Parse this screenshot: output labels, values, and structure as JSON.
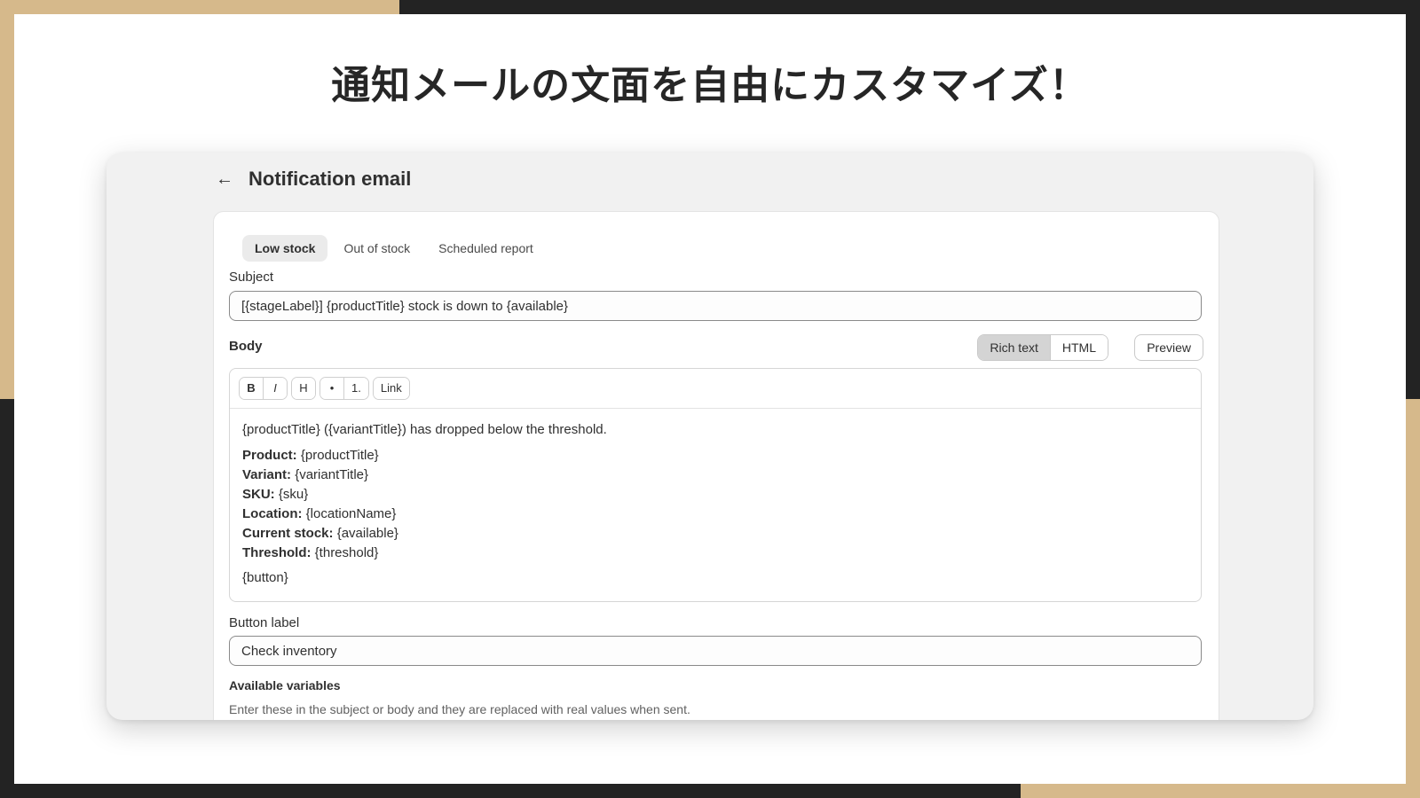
{
  "headline": "通知メールの文面を自由にカスタマイズ！",
  "page": {
    "back_icon": "arrow-left-icon",
    "title": "Notification email"
  },
  "tabs": [
    {
      "label": "Low stock",
      "active": true
    },
    {
      "label": "Out of stock",
      "active": false
    },
    {
      "label": "Scheduled report",
      "active": false
    }
  ],
  "subject": {
    "label": "Subject",
    "value": "[{stageLabel}] {productTitle} stock is down to {available}"
  },
  "body": {
    "label": "Body",
    "modes": [
      "Rich text",
      "HTML"
    ],
    "active_mode": "Rich text",
    "preview_label": "Preview",
    "toolbar": [
      "B",
      "I",
      "H",
      "•",
      "1.",
      "Link"
    ],
    "intro": "{productTitle} ({variantTitle}) has dropped below the threshold.",
    "fields": [
      {
        "label": "Product:",
        "value": "{productTitle}"
      },
      {
        "label": "Variant:",
        "value": "{variantTitle}"
      },
      {
        "label": "SKU:",
        "value": "{sku}"
      },
      {
        "label": "Location:",
        "value": "{locationName}"
      },
      {
        "label": "Current stock:",
        "value": "{available}"
      },
      {
        "label": "Threshold:",
        "value": "{threshold}"
      }
    ],
    "button_token": "{button}"
  },
  "button_label": {
    "label": "Button label",
    "value": "Check inventory"
  },
  "variables": {
    "title": "Available variables",
    "help": "Enter these in the subject or body and they are replaced with real values when sent."
  },
  "colors": {
    "tan": "#d6b98b",
    "dark": "#232323",
    "panel": "#f1f1f1"
  }
}
